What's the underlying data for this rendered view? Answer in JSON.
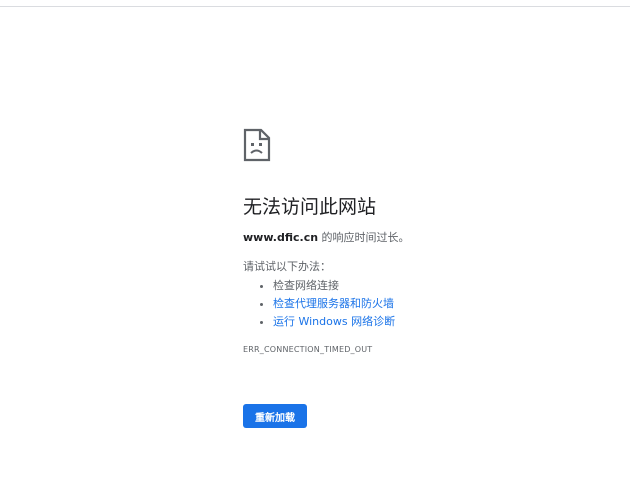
{
  "error": {
    "icon": "sad-page-icon",
    "heading": "无法访问此网站",
    "domain": "www.dfic.cn",
    "message": " 的响应时间过长。",
    "try_label": "请试试以下办法：",
    "suggestions": [
      {
        "label": "检查网络连接",
        "link": false
      },
      {
        "label": "检查代理服务器和防火墙",
        "link": true
      },
      {
        "label": "运行 Windows 网络诊断",
        "link": true
      }
    ],
    "code": "ERR_CONNECTION_TIMED_OUT"
  },
  "reload_button": {
    "label": "重新加载"
  },
  "colors": {
    "accent": "#1a73e8",
    "text": "#202124",
    "muted": "#5f6368"
  }
}
